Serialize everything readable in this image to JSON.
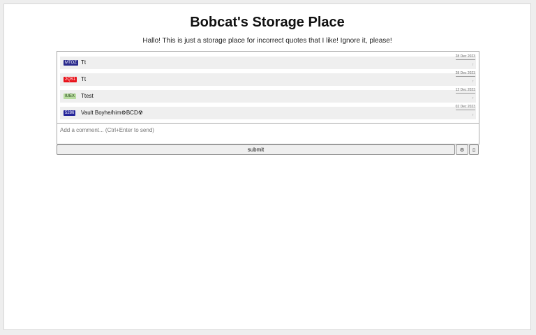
{
  "header": {
    "title": "Bobcat's Storage Place",
    "subtitle": "Hallo! This is just a storage place for incorrect quotes that I like! Ignore it, please!"
  },
  "comments": [
    {
      "badge": "MTOZ",
      "badge_bg": "#2a2a8c",
      "badge_fg": "#ffffff",
      "text": "Tt",
      "date": "28 Dec 2023",
      "reply": "↑"
    },
    {
      "badge": "2QS1",
      "badge_bg": "#e8121a",
      "badge_fg": "#ffffff",
      "text": "Tt",
      "date": "28 Dec 2023",
      "reply": "↑"
    },
    {
      "badge": "IUEX",
      "badge_bg": "#b8dca0",
      "badge_fg": "#1a3a10",
      "text": "Ttest",
      "date": "12 Dec 2023",
      "reply": "↑"
    },
    {
      "badge": "5286",
      "badge_bg": "#26269a",
      "badge_fg": "#ffffff",
      "text": "Vault Boyhe/him⚙BCD☢",
      "date": "02 Dec 2023",
      "reply": "↑"
    },
    {
      "badge": "",
      "badge_bg": "#ffffff",
      "badge_fg": "#ffffff",
      "text": "",
      "date": "",
      "reply": ""
    }
  ],
  "input": {
    "placeholder": "Add a comment... (Ctrl+Enter to send)"
  },
  "controls": {
    "submit_label": "submit",
    "gear_label": "⚙",
    "extra_label": "▯"
  }
}
